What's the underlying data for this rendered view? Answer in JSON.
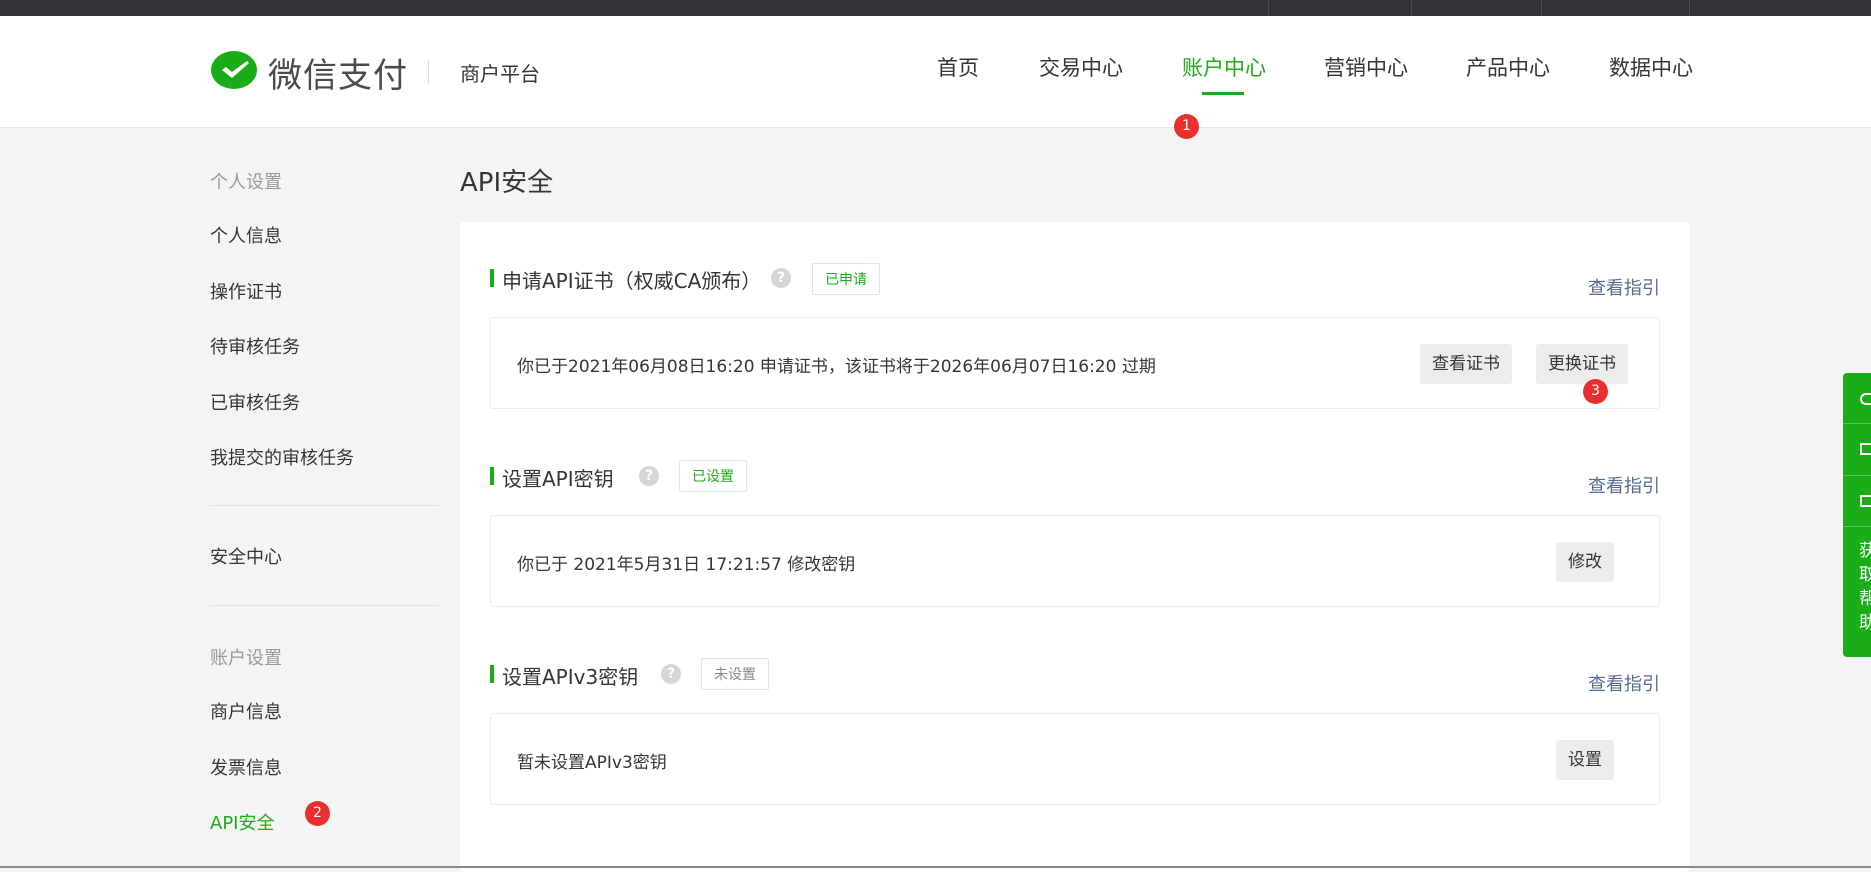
{
  "header": {
    "brand": "微信支付",
    "platform": "商户平台",
    "nav": [
      "首页",
      "交易中心",
      "账户中心",
      "营销中心",
      "产品中心",
      "数据中心"
    ],
    "active_nav": "账户中心"
  },
  "badges": [
    "1",
    "2",
    "3"
  ],
  "sidebar": {
    "group1_title": "个人设置",
    "group1_items": [
      "个人信息",
      "操作证书",
      "待审核任务",
      "已审核任务",
      "我提交的审核任务"
    ],
    "security": "安全中心",
    "group2_title": "账户设置",
    "group2_items": [
      "商户信息",
      "发票信息",
      "API安全"
    ],
    "active_item": "API安全"
  },
  "page_title": "API安全",
  "sections": [
    {
      "title": "申请API证书（权威CA颁布）",
      "help": "?",
      "status": "已申请",
      "guide": "查看指引",
      "info": "你已于2021年06月08日16:20 申请证书，该证书将于2026年06月07日16:20 过期",
      "buttons": [
        "查看证书",
        "更换证书"
      ]
    },
    {
      "title": "设置API密钥",
      "help": "?",
      "status": "已设置",
      "guide": "查看指引",
      "info": "你已于 2021年5月31日 17:21:57 修改密钥",
      "buttons": [
        "修改"
      ]
    },
    {
      "title": "设置APIv3密钥",
      "help": "?",
      "status": "未设置",
      "guide": "查看指引",
      "info": "暂未设置APIv3密钥",
      "buttons": [
        "设置"
      ]
    }
  ],
  "float_bar": {
    "text": "获取帮助"
  },
  "colors": {
    "brand_green": "#1aad19",
    "link_blue": "#576b95",
    "badge_red": "#e8312f",
    "top_strip": "#333438"
  }
}
